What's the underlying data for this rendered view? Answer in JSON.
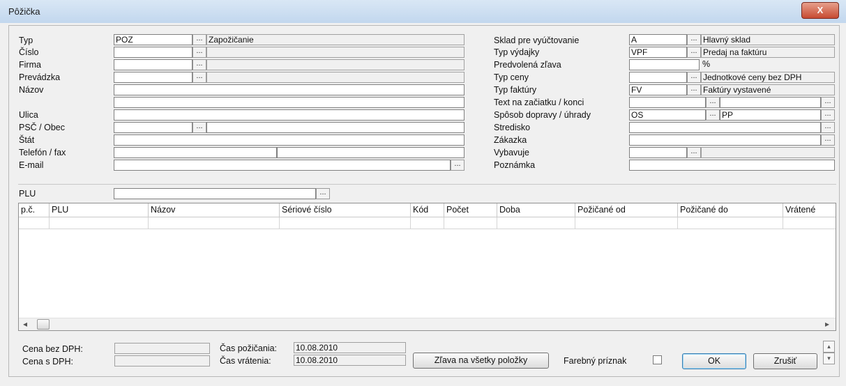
{
  "window": {
    "title": "Pôžička",
    "close_label": "X"
  },
  "left_form": {
    "typ": {
      "label": "Typ",
      "code": "POZ",
      "desc": "Zapožičanie"
    },
    "cislo": {
      "label": "Číslo"
    },
    "firma": {
      "label": "Firma"
    },
    "prevadzka": {
      "label": "Prevádzka"
    },
    "nazov": {
      "label": "Názov"
    },
    "ulica": {
      "label": "Ulica"
    },
    "psc": {
      "label": "PSČ / Obec"
    },
    "stat": {
      "label": "Štát"
    },
    "telefon": {
      "label": "Telefón / fax"
    },
    "email": {
      "label": "E-mail"
    }
  },
  "right_form": {
    "sklad": {
      "label": "Sklad pre vyúčtovanie",
      "code": "A",
      "desc": "Hlavný sklad"
    },
    "typ_vydajky": {
      "label": "Typ výdajky",
      "code": "VPF",
      "desc": "Predaj na faktúru"
    },
    "zlava": {
      "label": "Predvolená zľava",
      "unit": "%"
    },
    "typ_ceny": {
      "label": "Typ ceny",
      "desc": "Jednotkové ceny bez DPH"
    },
    "typ_faktury": {
      "label": "Typ faktúry",
      "code": "FV",
      "desc": "Faktúry vystavené"
    },
    "text": {
      "label": "Text na začiatku / konci"
    },
    "doprava": {
      "label": "Spôsob dopravy / úhrady",
      "code1": "OS",
      "code2": "PP"
    },
    "stredisko": {
      "label": "Stredisko"
    },
    "zakazka": {
      "label": "Zákazka"
    },
    "vybavuje": {
      "label": "Vybavuje"
    },
    "poznamka": {
      "label": "Poznámka"
    }
  },
  "plu": {
    "label": "PLU"
  },
  "grid": {
    "columns": [
      "p.č.",
      "PLU",
      "Názov",
      "Sériové číslo",
      "Kód",
      "Počet",
      "Doba",
      "Požičané od",
      "Požičané do",
      "Vrátené"
    ]
  },
  "footer": {
    "cena_bez_label": "Cena bez DPH:",
    "cena_s_label": "Cena s DPH:",
    "cas_pozicania_label": "Čas požičania:",
    "cas_pozicania": "10.08.2010",
    "cas_vratenia_label": "Čas vrátenia:",
    "cas_vratenia": "10.08.2010",
    "zlava_btn": "Zľava na všetky položky",
    "farebny_label": "Farebný príznak",
    "ok": "OK",
    "zrusit": "Zrušiť"
  },
  "icons": {
    "ellipsis": "...",
    "scroll_left": "◂",
    "scroll_right": "▸",
    "spin_up": "▴",
    "spin_down": "▾"
  }
}
